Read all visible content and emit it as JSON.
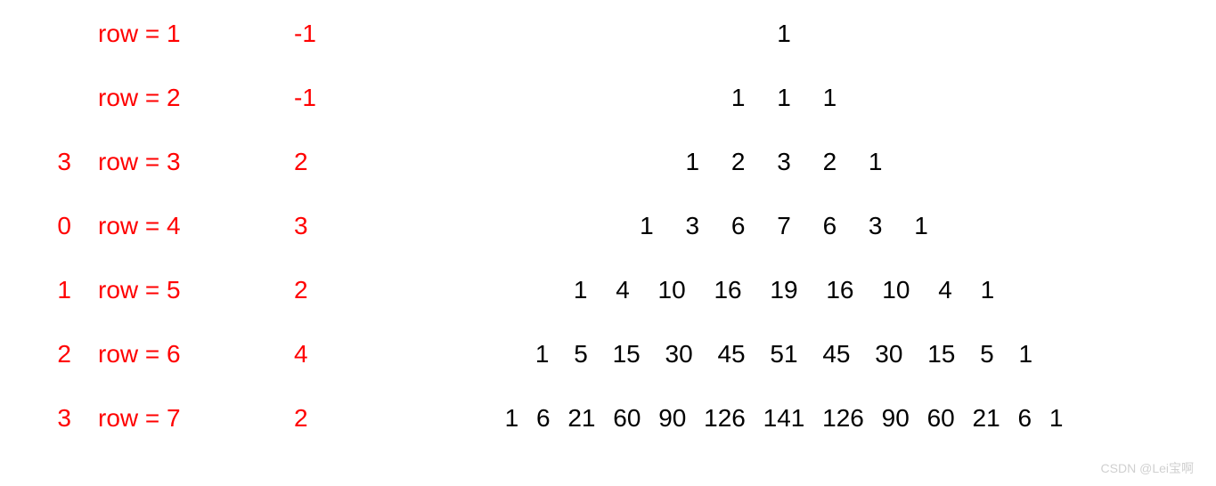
{
  "rows": [
    {
      "left": "",
      "label": "row = 1",
      "mid": "-1",
      "tri": [
        "1"
      ]
    },
    {
      "left": "",
      "label": "row = 2",
      "mid": "-1",
      "tri": [
        "1",
        "1",
        "1"
      ]
    },
    {
      "left": "3",
      "label": "row = 3",
      "mid": "2",
      "tri": [
        "1",
        "2",
        "3",
        "2",
        "1"
      ]
    },
    {
      "left": "0",
      "label": "row = 4",
      "mid": "3",
      "tri": [
        "1",
        "3",
        "6",
        "7",
        "6",
        "3",
        "1"
      ]
    },
    {
      "left": "1",
      "label": "row = 5",
      "mid": "2",
      "tri": [
        "1",
        "4",
        "10",
        "16",
        "19",
        "16",
        "10",
        "4",
        "1"
      ]
    },
    {
      "left": "2",
      "label": "row = 6",
      "mid": "4",
      "tri": [
        "1",
        "5",
        "15",
        "30",
        "45",
        "51",
        "45",
        "30",
        "15",
        "5",
        "1"
      ]
    },
    {
      "left": "3",
      "label": "row = 7",
      "mid": "2",
      "tri": [
        "1",
        "6",
        "21",
        "60",
        "90",
        "126",
        "141",
        "126",
        "90",
        "60",
        "21",
        "6",
        "1"
      ]
    }
  ],
  "watermark": "CSDN @Lei宝啊"
}
